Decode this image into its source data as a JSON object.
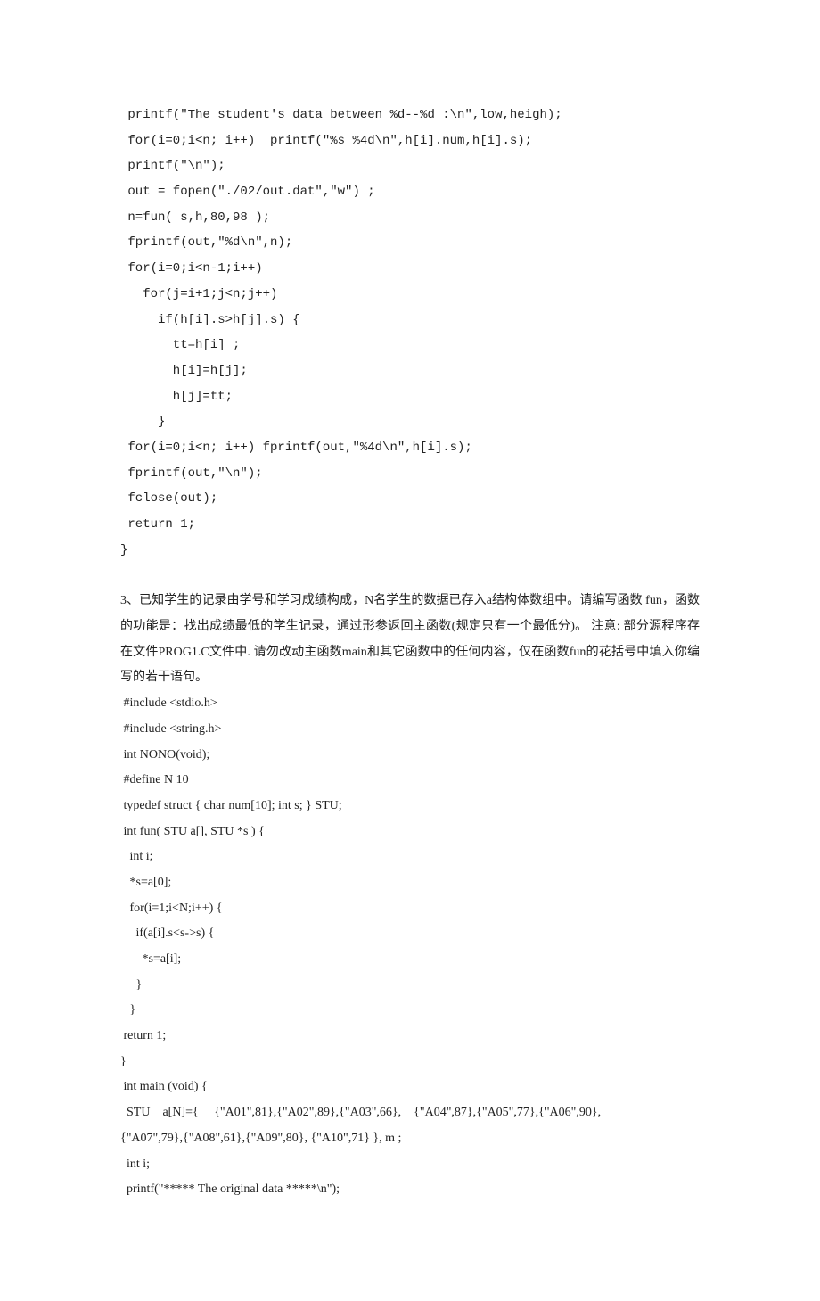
{
  "block1": " printf(\"The student's data between %d--%d :\\n\",low,heigh);\n for(i=0;i<n; i++)  printf(\"%s %4d\\n\",h[i].num,h[i].s);\n printf(\"\\n\");\n out = fopen(\"./02/out.dat\",\"w\") ;\n n=fun( s,h,80,98 );\n fprintf(out,\"%d\\n\",n);\n for(i=0;i<n-1;i++)\n   for(j=i+1;j<n;j++)\n     if(h[i].s>h[j].s) {\n       tt=h[i] ;\n       h[i]=h[j];\n       h[j]=tt;\n     }\n for(i=0;i<n; i++) fprintf(out,\"%4d\\n\",h[i].s);\n fprintf(out,\"\\n\");\n fclose(out);\n return 1;\n}",
  "prose": "3、已知学生的记录由学号和学习成绩构成，N名学生的数据已存入a结构体数组中。请编写函数 fun，函数的功能是：找出成绩最低的学生记录，通过形参返回主函数(规定只有一个最低分)。 注意: 部分源程序存在文件PROG1.C文件中.  请勿改动主函数main和其它函数中的任何内容，仅在函数fun的花括号中填入你编写的若干语句。",
  "block2": " #include <stdio.h>\n #include <string.h>\n int NONO(void);\n #define N 10\n typedef struct { char num[10]; int s; } STU;\n int fun( STU a[], STU *s ) {\n   int i;\n   *s=a[0];\n   for(i=1;i<N;i++) {\n     if(a[i].s<s->s) {\n       *s=a[i];\n     }\n   }\n return 1;\n}\n int main (void) {\n  STU    a[N]={     {\"A01\",81},{\"A02\",89},{\"A03\",66},    {\"A04\",87},{\"A05\",77},{\"A06\",90},\n{\"A07\",79},{\"A08\",61},{\"A09\",80}, {\"A10\",71} }, m ;\n  int i;\n  printf(\"***** The original data *****\\n\");"
}
